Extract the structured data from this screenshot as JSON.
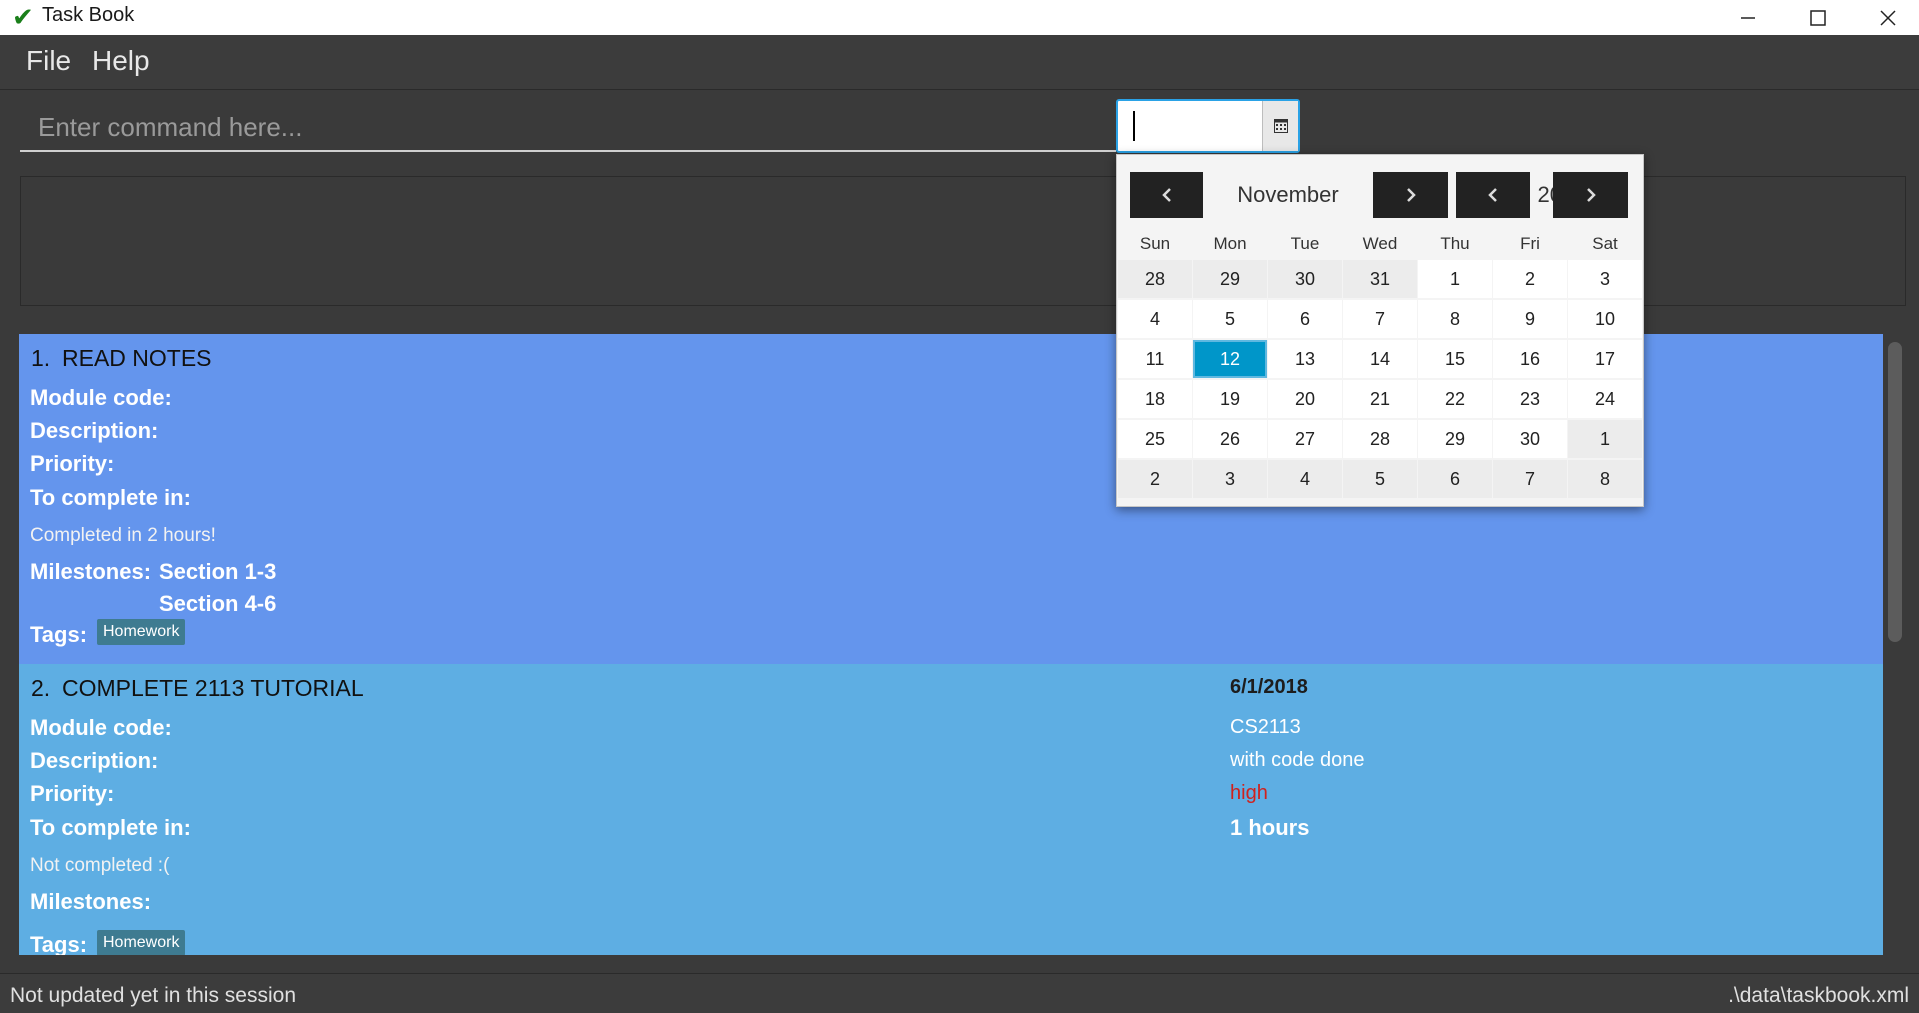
{
  "window": {
    "title": "Task Book",
    "check_icon": "✔",
    "min": "minimize-icon",
    "max": "maximize-icon",
    "close": "close-icon"
  },
  "menu": {
    "file": "File",
    "help": "Help"
  },
  "command": {
    "placeholder": "Enter command here..."
  },
  "tasks": [
    {
      "index": "1.",
      "name": "READ NOTES",
      "labels": {
        "module": "Module code:",
        "description": "Description:",
        "priority": "Priority:",
        "to_complete": "To complete in:",
        "milestones": "Milestones:",
        "tags": "Tags:"
      },
      "status": "Completed in 2 hours!",
      "milestones": [
        "Section 1-3",
        "Section 4-6"
      ],
      "tags": [
        "Homework"
      ]
    },
    {
      "index": "2.",
      "name": "COMPLETE 2113 TUTORIAL",
      "labels": {
        "module": "Module code:",
        "description": "Description:",
        "priority": "Priority:",
        "to_complete": "To complete in:",
        "milestones": "Milestones:",
        "tags": "Tags:"
      },
      "deadline": "6/1/2018",
      "module_code": "CS2113",
      "description": "with code done",
      "priority": "high",
      "duration": "1 hours",
      "status": "Not completed :(",
      "tags": [
        "Homework"
      ]
    }
  ],
  "status_bar": {
    "left": "Not updated yet in this session",
    "right": ".\\data\\taskbook.xml"
  },
  "date_picker": {
    "value": "",
    "month": "November",
    "year": "2018",
    "days_of_week": [
      "Sun",
      "Mon",
      "Tue",
      "Wed",
      "Thu",
      "Fri",
      "Sat"
    ],
    "weeks": [
      [
        "28",
        "29",
        "30",
        "31",
        "1",
        "2",
        "3"
      ],
      [
        "4",
        "5",
        "6",
        "7",
        "8",
        "9",
        "10"
      ],
      [
        "11",
        "12",
        "13",
        "14",
        "15",
        "16",
        "17"
      ],
      [
        "18",
        "19",
        "20",
        "21",
        "22",
        "23",
        "24"
      ],
      [
        "25",
        "26",
        "27",
        "28",
        "29",
        "30",
        "1"
      ],
      [
        "2",
        "3",
        "4",
        "5",
        "6",
        "7",
        "8"
      ]
    ],
    "selected_day": "12"
  },
  "colors": {
    "card1": "#6495ed",
    "card2": "#5eaee3",
    "priority_high": "#d0211c",
    "tag_bg": "#3e7b91",
    "selected_day": "#0096c9"
  }
}
